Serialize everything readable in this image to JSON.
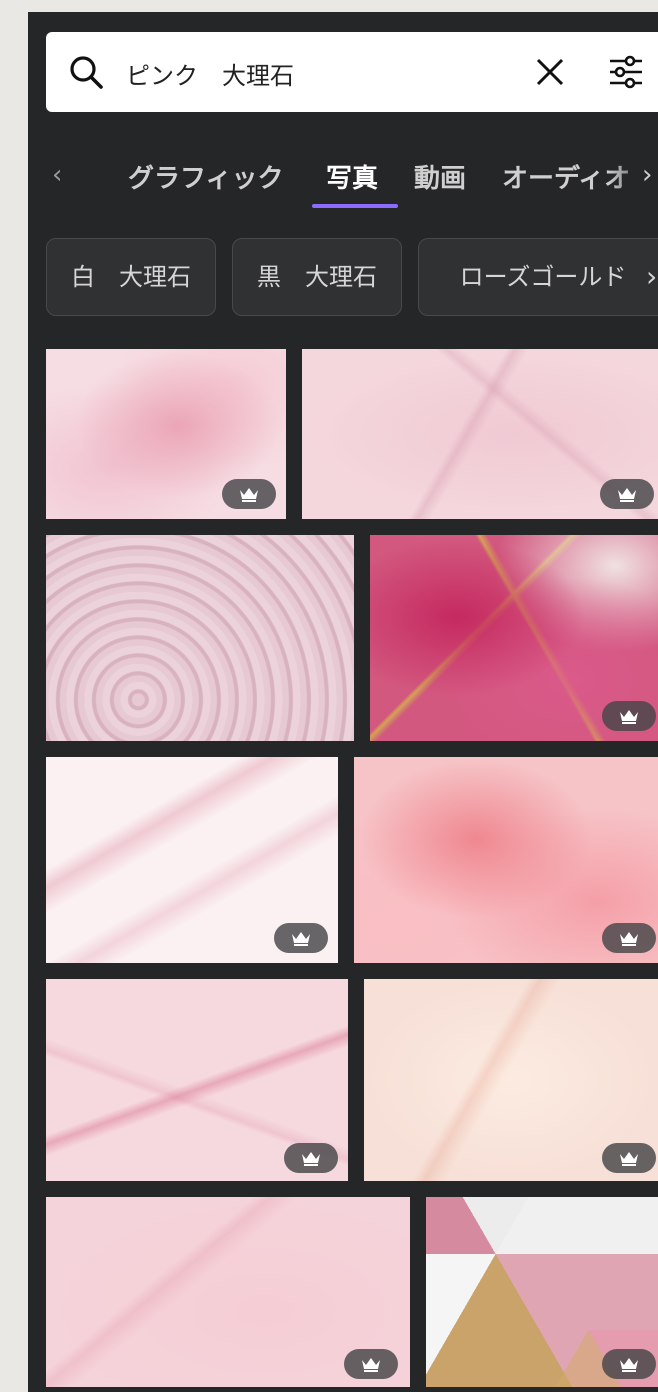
{
  "search": {
    "query": "ピンク　大理石"
  },
  "tabs": {
    "items": [
      "グラフィック",
      "写真",
      "動画",
      "オーディオ"
    ],
    "active": "写真"
  },
  "chips": [
    "白　大理石",
    "黒　大理石",
    "ローズゴールド"
  ],
  "images": [
    {
      "name": "pink-marble-alcohol-ink",
      "premium": true
    },
    {
      "name": "pink-marble-veins",
      "premium": true
    },
    {
      "name": "pink-swirl-marble",
      "premium": false
    },
    {
      "name": "magenta-gold-marble",
      "premium": true
    },
    {
      "name": "light-pink-marble",
      "premium": true
    },
    {
      "name": "pink-gold-alcohol-ink",
      "premium": true
    },
    {
      "name": "pink-veined-marble",
      "premium": true
    },
    {
      "name": "peach-marble",
      "premium": true
    },
    {
      "name": "soft-pink-marble",
      "premium": true
    },
    {
      "name": "geometric-marble-gold",
      "premium": true
    }
  ],
  "colors": {
    "panel_bg": "#252627",
    "tab_underline": "#8b6cff"
  },
  "icons": {
    "search": "search-icon",
    "clear": "close-icon",
    "filter": "sliders-icon",
    "premium": "crown-icon"
  }
}
